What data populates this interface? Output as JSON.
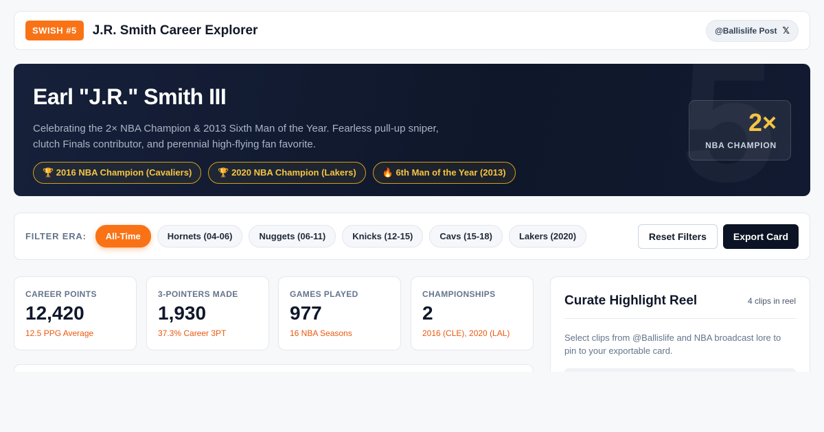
{
  "header": {
    "badge": "SWISH #5",
    "title": "J.R. Smith Career Explorer",
    "post_chip": "@Ballislife Post",
    "x_icon_glyph": "𝕏"
  },
  "hero": {
    "name": "Earl \"J.R.\" Smith III",
    "description": "Celebrating the 2× NBA Champion & 2013 Sixth Man of the Year. Fearless pull-up sniper, clutch Finals contributor, and perennial high-flying fan favorite.",
    "pills": [
      "🏆 2016 NBA Champion (Cavaliers)",
      "🏆 2020 NBA Champion (Lakers)",
      "🔥 6th Man of the Year (2013)"
    ],
    "background_number": "5",
    "champ_count": "2×",
    "champ_label": "NBA CHAMPION"
  },
  "filters": {
    "label": "FILTER ERA:",
    "eras": [
      "All-Time",
      "Hornets (04-06)",
      "Nuggets (06-11)",
      "Knicks (12-15)",
      "Cavs (15-18)",
      "Lakers (2020)"
    ],
    "active": "All-Time",
    "reset_label": "Reset Filters",
    "export_label": "Export Card"
  },
  "stats": [
    {
      "label": "CAREER POINTS",
      "value": "12,420",
      "sub": "12.5 PPG Average"
    },
    {
      "label": "3-POINTERS MADE",
      "value": "1,930",
      "sub": "37.3% Career 3PT"
    },
    {
      "label": "GAMES PLAYED",
      "value": "977",
      "sub": "16 NBA Seasons"
    },
    {
      "label": "CHAMPIONSHIPS",
      "value": "2",
      "sub": "2016 (CLE), 2020 (LAL)"
    }
  ],
  "reel": {
    "title": "Curate Highlight Reel",
    "count": "4 clips in reel",
    "description": "Select clips from @Ballislife and NBA broadcast lore to pin to your exportable card."
  },
  "colors": {
    "accent": "#f97316",
    "gold": "#f5c542",
    "navy": "#0f172a"
  }
}
